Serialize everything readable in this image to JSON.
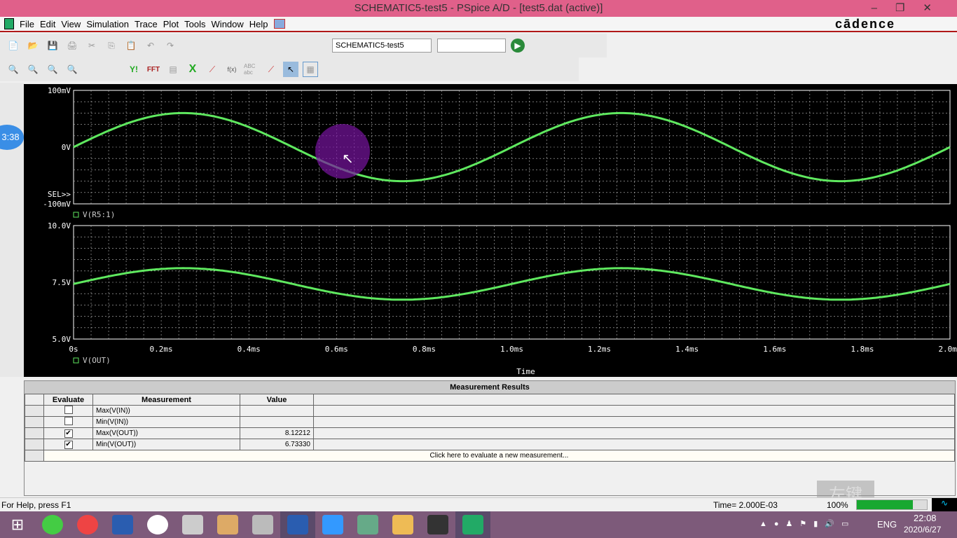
{
  "window": {
    "title": "SCHEMATIC5-test5 - PSpice A/D  - [test5.dat (active)]",
    "brand": "cādence"
  },
  "menu": [
    "File",
    "Edit",
    "View",
    "Simulation",
    "Trace",
    "Plot",
    "Tools",
    "Window",
    "Help"
  ],
  "toolbar": {
    "profile": "SCHEMATIC5-test5",
    "sim_field": "",
    "icons": [
      "new-icon",
      "open-icon",
      "save-icon",
      "print-icon",
      "cut-icon",
      "copy-icon",
      "paste-icon",
      "undo-icon",
      "redo-icon",
      "run-icon"
    ],
    "icons2": [
      "zoom-in-icon",
      "zoom-out-icon",
      "zoom-area-icon",
      "zoom-fit-icon",
      "y-axis-icon",
      "fft-icon",
      "evaluate-icon",
      "excel-icon",
      "add-trace-icon",
      "function-icon",
      "label-icon",
      "marker-icon",
      "select-icon",
      "grid-icon"
    ],
    "y_label": "Y!",
    "fft_label": "FFT",
    "abc_label": "ABC abc",
    "fx_label": "f(x)"
  },
  "overlay": {
    "timer": "3:38",
    "watermark": "左键"
  },
  "chart_data": [
    {
      "type": "line",
      "ylim": [
        -0.1,
        0.1
      ],
      "yticks": [
        "100mV",
        "0V",
        "-100mV"
      ],
      "sel_label": "SEL>>",
      "xlim": [
        0,
        0.002
      ],
      "series": [
        {
          "name": "V(R5:1)",
          "offset": 0,
          "amplitude": 0.06,
          "frequency_hz": 1000
        }
      ]
    },
    {
      "type": "line",
      "ylim": [
        5,
        10
      ],
      "yticks": [
        "10.0V",
        "7.5V",
        "5.0V"
      ],
      "xlim": [
        0,
        0.002
      ],
      "xticks": [
        "0s",
        "0.2ms",
        "0.4ms",
        "0.6ms",
        "0.8ms",
        "1.0ms",
        "1.2ms",
        "1.4ms",
        "1.6ms",
        "1.8ms",
        "2.0ms"
      ],
      "xlabel": "Time",
      "series": [
        {
          "name": "V(OUT)",
          "offset": 7.4277,
          "amplitude": 0.6944,
          "frequency_hz": 1000
        }
      ]
    }
  ],
  "trace_color": "#5fe85f",
  "measurements": {
    "title": "Measurement Results",
    "headers": [
      "Evaluate",
      "Measurement",
      "Value"
    ],
    "rows": [
      {
        "checked": false,
        "name": "Max(V(IN))",
        "value": ""
      },
      {
        "checked": false,
        "name": "Min(V(IN))",
        "value": ""
      },
      {
        "checked": true,
        "name": "Max(V(OUT))",
        "value": "8.12212"
      },
      {
        "checked": true,
        "name": "Min(V(OUT))",
        "value": "6.73330"
      }
    ],
    "new_row": "Click here to evaluate a new measurement..."
  },
  "status": {
    "help": "For Help, press F1",
    "time": "Time= 2.000E-03",
    "progress_text": "100%",
    "progress": 1.0
  },
  "taskbar": {
    "lang": "ENG",
    "time": "22:08",
    "date": "2020/6/27"
  }
}
